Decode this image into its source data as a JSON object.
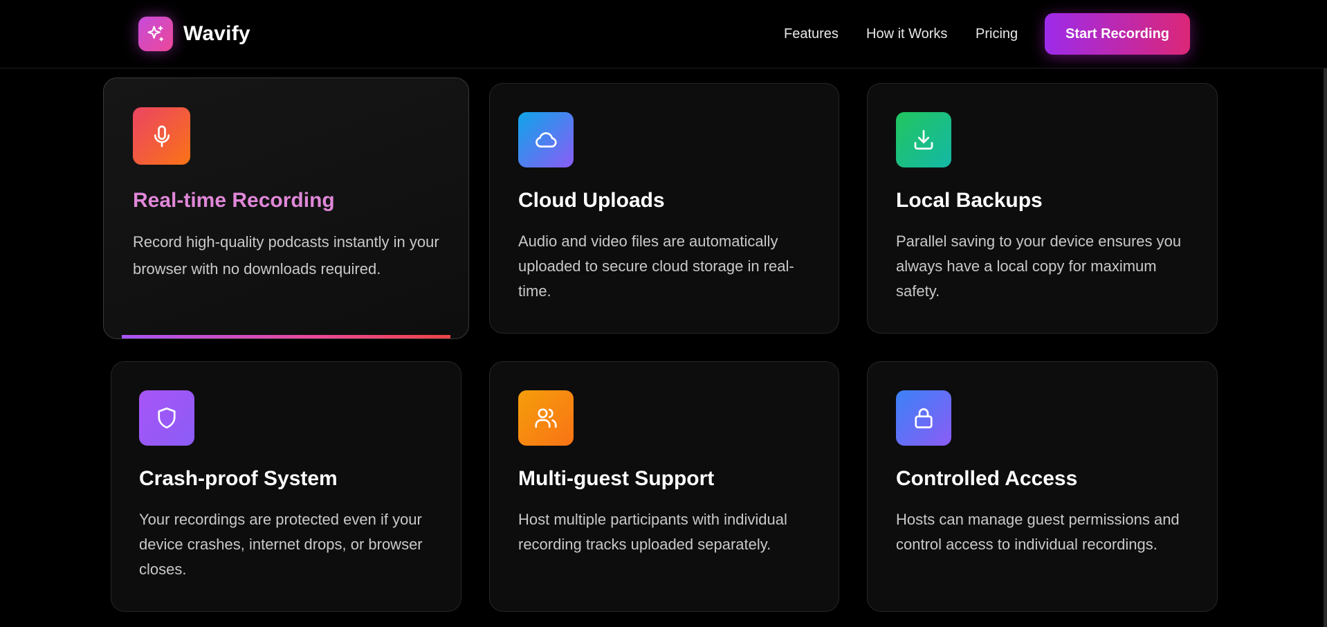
{
  "brand": {
    "name": "Wavify",
    "logo_icon": "sparkles-icon"
  },
  "nav": {
    "links": [
      "Features",
      "How it Works",
      "Pricing"
    ],
    "cta_label": "Start Recording"
  },
  "features": [
    {
      "title": "Real-time Recording",
      "description": "Record high-quality podcasts instantly in your browser with no downloads required.",
      "icon": "microphone-icon",
      "state": "hovered"
    },
    {
      "title": "Cloud Uploads",
      "description": "Audio and video files are automatically uploaded to secure cloud storage in real-time.",
      "icon": "cloud-icon"
    },
    {
      "title": "Local Backups",
      "description": "Parallel saving to your device ensures you always have a local copy for maximum safety.",
      "icon": "download-icon"
    },
    {
      "title": "Crash-proof System",
      "description": "Your recordings are protected even if your device crashes, internet drops, or browser closes.",
      "icon": "shield-icon"
    },
    {
      "title": "Multi-guest Support",
      "description": "Host multiple participants with individual recording tracks uploaded separately.",
      "icon": "users-icon"
    },
    {
      "title": "Controlled Access",
      "description": "Hosts can manage guest permissions and control access to individual recordings.",
      "icon": "lock-icon"
    }
  ],
  "colors": {
    "background": "#000000",
    "card": "#0d0d0d",
    "active_title": "#e087d8",
    "cta_start": "#9d2bea",
    "cta_end": "#db2777"
  }
}
